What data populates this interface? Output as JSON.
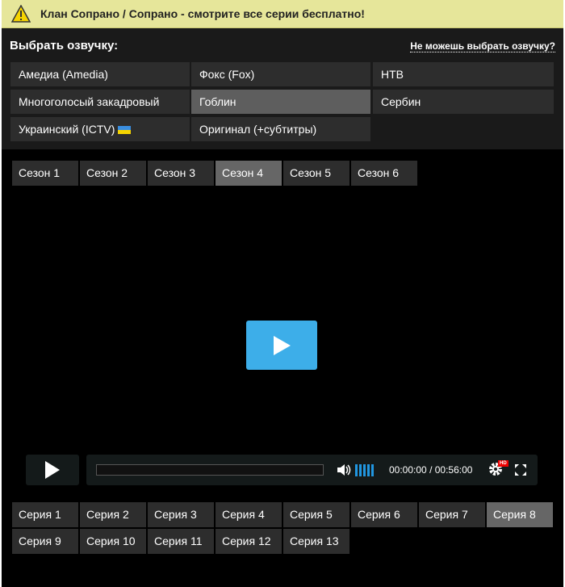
{
  "banner": {
    "text": "Клан Сопрано / Сопрано - смотрите все серии бесплатно!"
  },
  "voice": {
    "title": "Выбрать озвучку:",
    "help_link": "Не можешь выбрать озвучку?",
    "options": [
      "Амедиа (Amedia)",
      "Фокс (Fox)",
      "НТВ",
      "Многоголосый закадровый",
      "Гоблин",
      "Сербин",
      "Украинский (ICTV)",
      "Оригинал (+субтитры)"
    ],
    "selected": "Гоблин"
  },
  "seasons": [
    "Сезон 1",
    "Сезон 2",
    "Сезон 3",
    "Сезон 4",
    "Сезон 5",
    "Сезон 6"
  ],
  "selected_season": "Сезон 4",
  "player": {
    "current_time": "00:00:00",
    "separator": "/",
    "duration": "00:56:00",
    "quality_badge": "HD",
    "progress": 0,
    "volume": 1.0,
    "accent": "#3daee9"
  },
  "episodes": [
    "Серия 1",
    "Серия 2",
    "Серия 3",
    "Серия 4",
    "Серия 5",
    "Серия 6",
    "Серия 7",
    "Серия 8",
    "Серия 9",
    "Серия 10",
    "Серия 11",
    "Серия 12",
    "Серия 13"
  ],
  "selected_episode": "Серия 8"
}
